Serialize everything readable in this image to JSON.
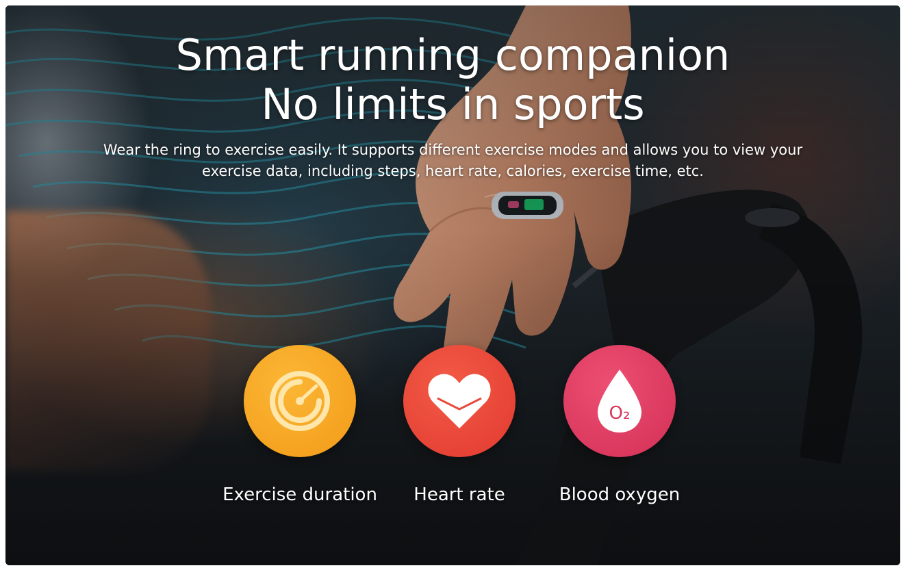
{
  "headline": {
    "line1": "Smart running companion",
    "line2": "No limits in sports"
  },
  "description": {
    "line1": "Wear the ring to exercise easily. It supports different exercise modes and allows you to view your",
    "line2": "exercise data, including steps, heart rate, calories, exercise time, etc."
  },
  "features": [
    {
      "label": "Exercise duration",
      "icon": "gauge-icon",
      "color": "#f6a421"
    },
    {
      "label": "Heart rate",
      "icon": "heart-icon",
      "color": "#ec4a3a"
    },
    {
      "label": "Blood oxygen",
      "icon": "oxygen-drop-icon",
      "color": "#e03e62",
      "icon_text": "O₂"
    }
  ]
}
